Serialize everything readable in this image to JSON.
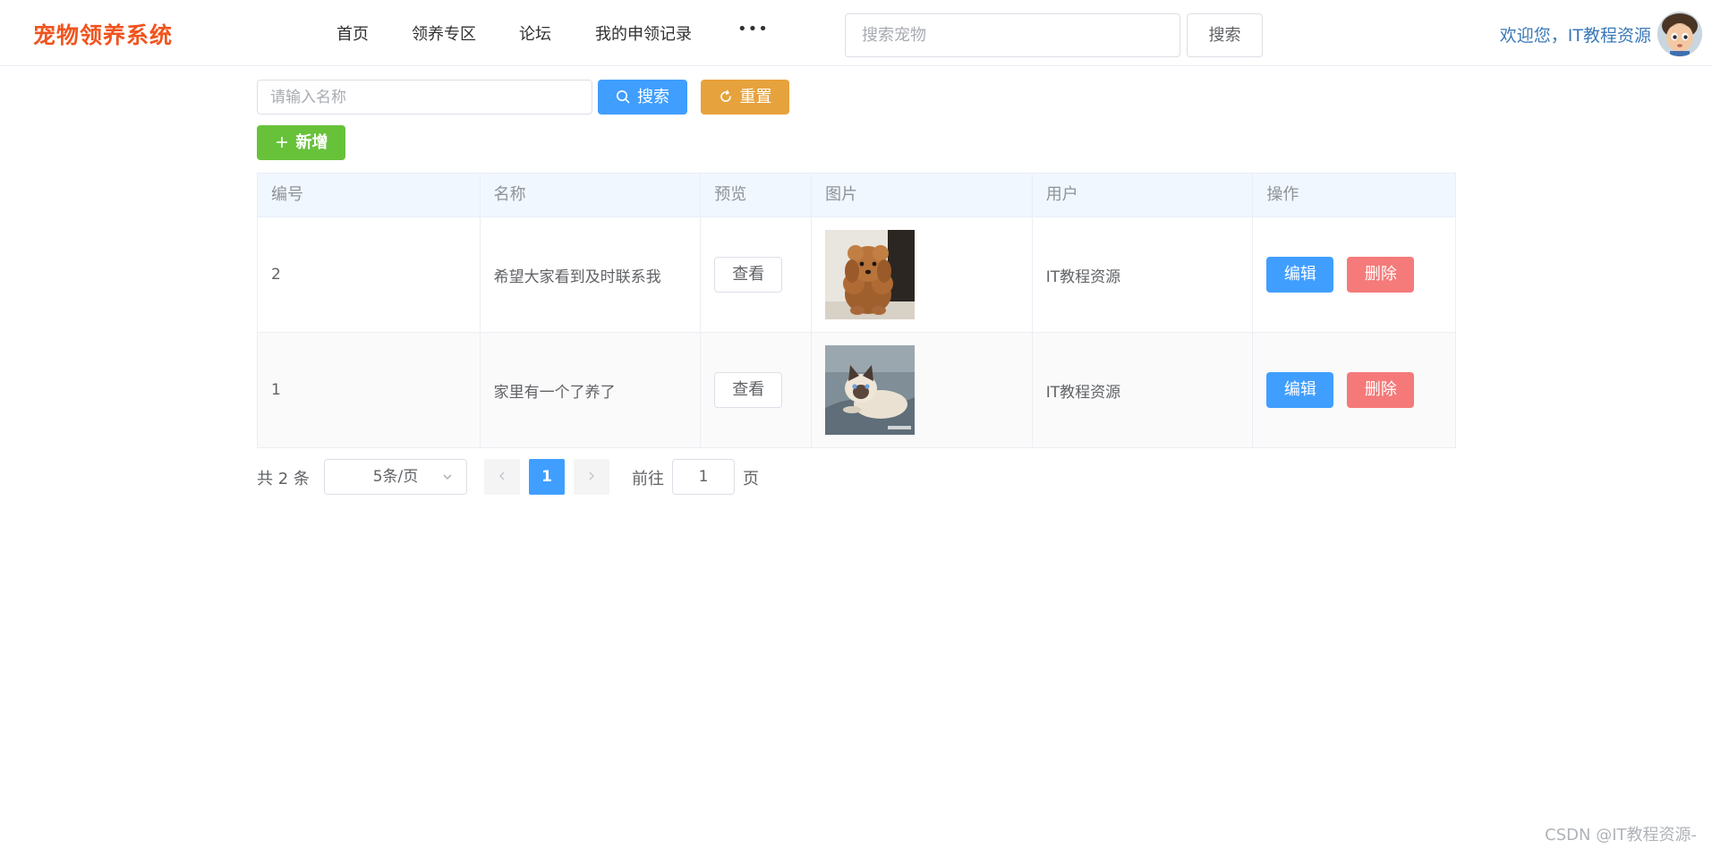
{
  "app": {
    "title": "宠物领养系统"
  },
  "nav": {
    "items": [
      {
        "label": "首页"
      },
      {
        "label": "领养专区"
      },
      {
        "label": "论坛"
      },
      {
        "label": "我的申领记录"
      }
    ],
    "more_label": "•••"
  },
  "top_search": {
    "placeholder": "搜索宠物",
    "value": "",
    "button_label": "搜索"
  },
  "user": {
    "welcome": "欢迎您，IT教程资源"
  },
  "filter": {
    "name_placeholder": "请输入名称",
    "name_value": "",
    "search_label": "搜索",
    "reset_label": "重置",
    "add_label": "新增"
  },
  "table": {
    "columns": [
      "编号",
      "名称",
      "预览",
      "图片",
      "用户",
      "操作"
    ],
    "rows": [
      {
        "id": "2",
        "name": "希望大家看到及时联系我",
        "view_label": "查看",
        "image": "poodle-photo",
        "user": "IT教程资源",
        "edit_label": "编辑",
        "delete_label": "删除"
      },
      {
        "id": "1",
        "name": "家里有一个了养了",
        "view_label": "查看",
        "image": "siamese-cat-photo",
        "user": "IT教程资源",
        "edit_label": "编辑",
        "delete_label": "删除"
      }
    ]
  },
  "pagination": {
    "total_text": "共 2 条",
    "page_size": "5条/页",
    "current_page": "1",
    "goto_prefix": "前往",
    "goto_value": "1",
    "goto_suffix": "页"
  },
  "watermark": "CSDN @IT教程资源-",
  "colors": {
    "logo": "#f0541e",
    "primary": "#409eff",
    "warning": "#e6a23c",
    "success": "#67c23a",
    "danger": "#f56c6c"
  }
}
